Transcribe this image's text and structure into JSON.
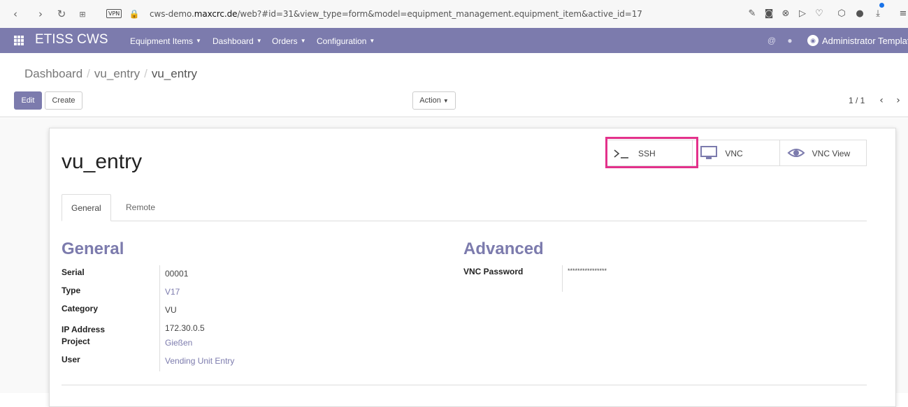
{
  "browser": {
    "url_prefix": "cws-demo.",
    "url_host": "maxcrc.de",
    "url_path": "/web?#id=31&view_type=form&model=equipment_management.equipment_item&active_id=17",
    "vpn_label": "VPN"
  },
  "navbar": {
    "brand": "ETISS CWS",
    "menus": [
      {
        "label": "Equipment Items"
      },
      {
        "label": "Dashboard"
      },
      {
        "label": "Orders"
      },
      {
        "label": "Configuration"
      }
    ],
    "user_name": "Administrator Template",
    "accent": "#7c7bad"
  },
  "control_panel": {
    "breadcrumb": [
      "Dashboard",
      "vu_entry",
      "vu_entry"
    ],
    "edit_label": "Edit",
    "create_label": "Create",
    "action_label": "Action",
    "pager": "1 / 1"
  },
  "form": {
    "title": "vu_entry",
    "smart_buttons": [
      {
        "label": "SSH",
        "icon": "terminal-icon"
      },
      {
        "label": "VNC",
        "icon": "monitor-icon"
      },
      {
        "label": "VNC View",
        "icon": "eye-icon"
      }
    ],
    "highlight_color": "#e3318b",
    "tabs": [
      {
        "label": "General"
      },
      {
        "label": "Remote"
      }
    ],
    "general": {
      "title": "General",
      "fields": [
        {
          "label": "Serial",
          "value": "00001"
        },
        {
          "label": "Type",
          "value": "V17"
        },
        {
          "label": "Category",
          "value": "VU"
        },
        {
          "label": "IP Address",
          "value": "172.30.0.5"
        },
        {
          "label": "Project",
          "value": "Gießen"
        },
        {
          "label": "User",
          "value": "Vending Unit Entry"
        }
      ]
    },
    "advanced": {
      "title": "Advanced",
      "fields": [
        {
          "label": "VNC Password",
          "value": "****************"
        }
      ]
    }
  }
}
